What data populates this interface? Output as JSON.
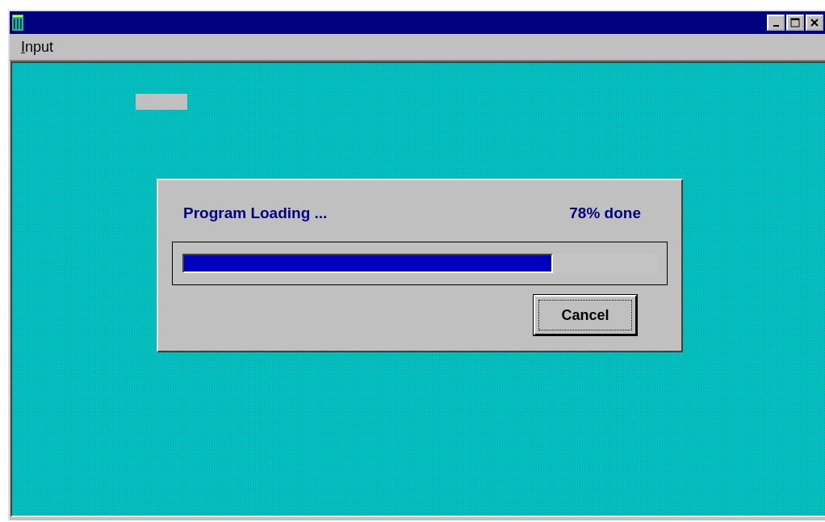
{
  "menu": [
    {
      "label": "Input"
    }
  ],
  "dialog": {
    "message": "Program Loading ...",
    "percent_text": "78% done",
    "progress": {
      "level": 0.78
    },
    "buttons": [
      {
        "label": "Cancel",
        "focused": true
      }
    ]
  }
}
